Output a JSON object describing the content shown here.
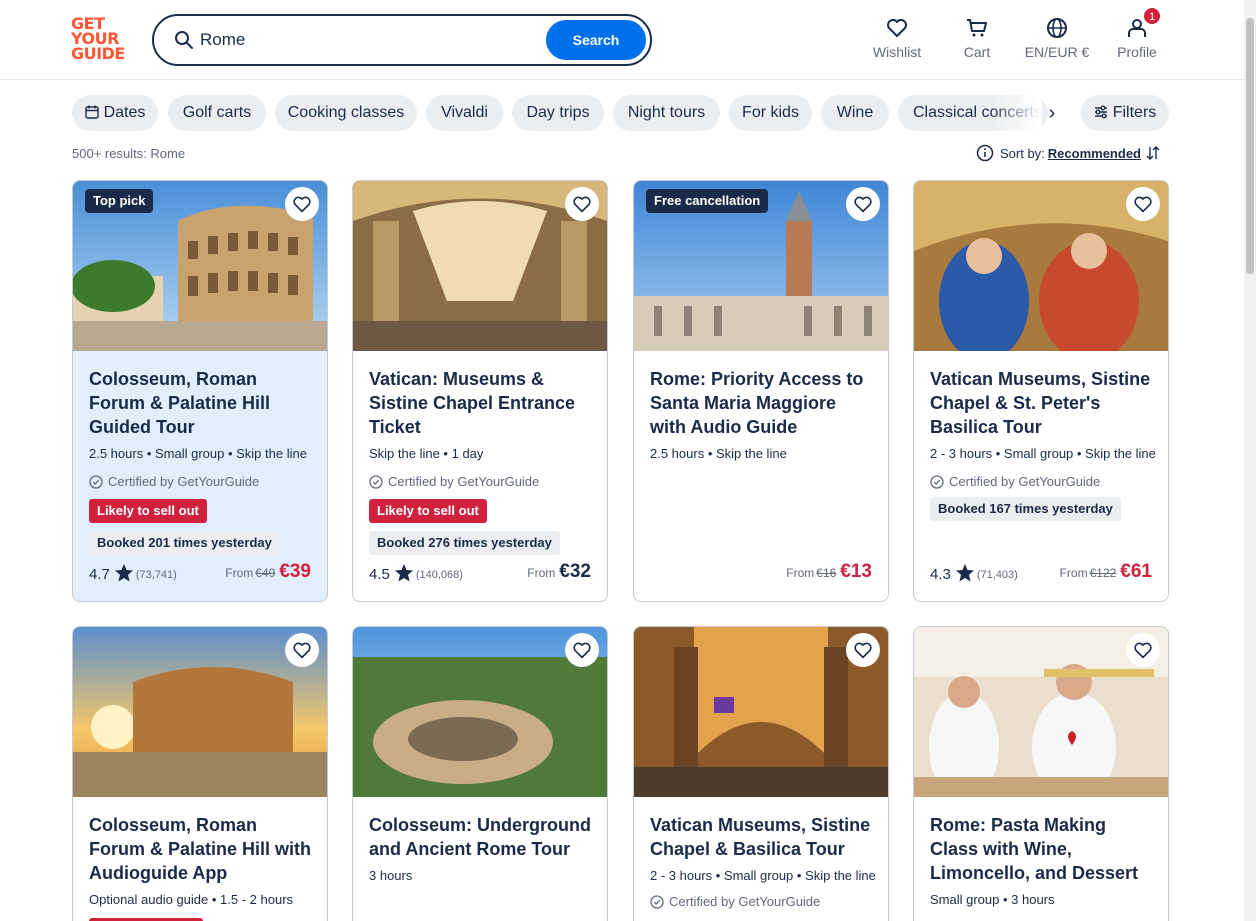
{
  "logo": [
    "GET",
    "YOUR",
    "GUIDE"
  ],
  "search": {
    "value": "Rome",
    "button": "Search"
  },
  "nav": {
    "wishlist": "Wishlist",
    "cart": "Cart",
    "language": "EN/EUR €",
    "profile": "Profile",
    "profile_badge": "1"
  },
  "chips": [
    "Dates",
    "Golf carts",
    "Cooking classes",
    "Vivaldi",
    "Day trips",
    "Night tours",
    "For kids",
    "Wine",
    "Classical concerts"
  ],
  "filters_label": "Filters",
  "results": "500+ results: Rome",
  "sort": {
    "label": "Sort by:",
    "value": "Recommended"
  },
  "cards": [
    {
      "tag": "Top pick",
      "title": "Colosseum, Roman Forum & Palatine Hill Guided Tour",
      "meta": "2.5 hours • Small group • Skip the line",
      "certified": "Certified by GetYourGuide",
      "sell": "Likely to sell out",
      "booked": "Booked 201 times yesterday",
      "rating": "4.7",
      "count": "(73,741)",
      "from": "From",
      "old": "€49",
      "price": "€39"
    },
    {
      "tag": "",
      "title": "Vatican: Museums & Sistine Chapel Entrance Ticket",
      "meta": "Skip the line • 1 day",
      "certified": "Certified by GetYourGuide",
      "sell": "Likely to sell out",
      "booked": "Booked 276 times yesterday",
      "rating": "4.5",
      "count": "(140,068)",
      "from": "From",
      "old": "",
      "price": "€32"
    },
    {
      "tag": "Free cancellation",
      "title": "Rome: Priority Access to Santa Maria Maggiore with Audio Guide",
      "meta": "2.5 hours • Skip the line",
      "certified": "",
      "sell": "",
      "booked": "",
      "rating": "",
      "count": "",
      "from": "From",
      "old": "€16",
      "price": "€13"
    },
    {
      "tag": "",
      "title": "Vatican Museums, Sistine Chapel & St. Peter's Basilica Tour",
      "meta": "2 - 3 hours • Small group • Skip the line",
      "certified": "Certified by GetYourGuide",
      "sell": "",
      "booked": "Booked 167 times yesterday",
      "rating": "4.3",
      "count": "(71,403)",
      "from": "From",
      "old": "€122",
      "price": "€61"
    },
    {
      "tag": "",
      "title": "Colosseum, Roman Forum & Palatine Hill with Audioguide App",
      "meta": "Optional audio guide • 1.5 - 2 hours"
    },
    {
      "tag": "",
      "title": "Colosseum: Underground and Ancient Rome Tour",
      "meta": "3 hours"
    },
    {
      "tag": "",
      "title": "Vatican Museums, Sistine Chapel & Basilica Tour",
      "meta": "2 - 3 hours • Small group • Skip the line",
      "certified": "Certified by GetYourGuide"
    },
    {
      "tag": "",
      "title": "Rome: Pasta Making Class with Wine, Limoncello, and Dessert",
      "meta": "Small group • 3 hours"
    }
  ],
  "colors": {
    "brand": "#ff5533",
    "primary": "#0071eb",
    "ink": "#1a2b49",
    "sale": "#d0213d",
    "highlight": "#e1eefc"
  }
}
